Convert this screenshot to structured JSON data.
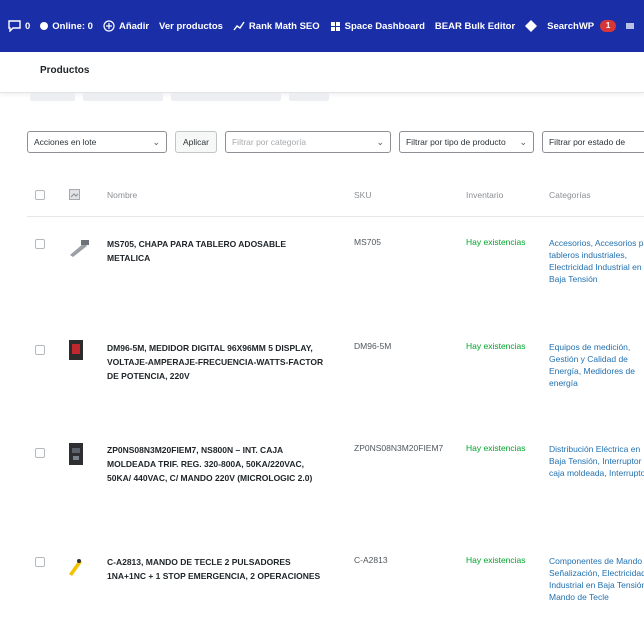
{
  "adminbar": {
    "comments_count": "0",
    "online": "Online: 0",
    "add": "Añadir",
    "view_products": "Ver productos",
    "rank_math": "Rank Math SEO",
    "space_dashboard": "Space Dashboard",
    "bear": "BEAR Bulk Editor",
    "searchwp": "SearchWP",
    "searchwp_badge": "1"
  },
  "page": {
    "title": "Productos"
  },
  "toolbar": {
    "bulk_actions": "Acciones en lote",
    "apply": "Aplicar",
    "filter_category_placeholder": "Filtrar por categoría",
    "filter_type": "Filtrar por tipo de producto",
    "filter_status": "Filtrar por estado de"
  },
  "table": {
    "headers": {
      "name": "Nombre",
      "sku": "SKU",
      "inventory": "Inventario",
      "categories": "Categorías"
    },
    "rows": [
      {
        "name": "MS705, CHAPA PARA TABLERO ADOSABLE METALICA",
        "sku": "MS705",
        "stock": "Hay existencias",
        "categories": "Accesorios, Accesorios para tableros industriales, Electricidad Industrial en Baja Tensión"
      },
      {
        "name": "DM96-5M, MEDIDOR DIGITAL 96X96MM 5 DISPLAY, VOLTAJE-AMPERAJE-FRECUENCIA-WATTS-FACTOR DE POTENCIA, 220V",
        "sku": "DM96-5M",
        "stock": "Hay existencias",
        "categories": "Equipos de medición, Gestión y Calidad de Energía, Medidores de energía"
      },
      {
        "name": "ZP0NS08N3M20FIEM7, NS800N – INT. CAJA MOLDEADA TRIF. REG. 320-800A, 50KA/220VAC, 50KA/ 440VAC, C/ MANDO 220V (MICROLOGIC 2.0)",
        "sku": "ZP0NS08N3M20FIEM7",
        "stock": "Hay existencias",
        "categories": "Distribución Eléctrica en Baja Tensión, Interruptor de caja moldeada, Interruptores"
      },
      {
        "name": "C-A2813, MANDO DE TECLE 2 PULSADORES 1NA+1NC + 1 STOP EMERGENCIA, 2 OPERACIONES",
        "sku": "C-A2813",
        "stock": "Hay existencias",
        "categories": "Componentes de Mando y Señalización, Electricidad Industrial en Baja Tensión, Mando de Tecle"
      }
    ]
  }
}
